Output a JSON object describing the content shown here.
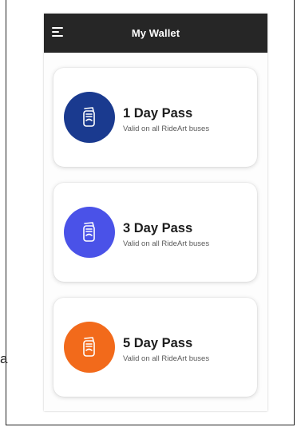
{
  "header": {
    "title": "My Wallet",
    "menu_icon": "hamburger-menu-icon"
  },
  "passes": [
    {
      "name": "1 Day Pass",
      "description": "Valid on all RideArt buses",
      "color": "#1a3a8f",
      "icon": "ticket-pass-icon"
    },
    {
      "name": "3 Day Pass",
      "description": "Valid on all RideArt buses",
      "color": "#4a52e8",
      "icon": "ticket-pass-icon"
    },
    {
      "name": "5 Day Pass",
      "description": "Valid on all RideArt buses",
      "color": "#f26a1b",
      "icon": "ticket-pass-icon"
    }
  ],
  "edge_glyph": "a"
}
